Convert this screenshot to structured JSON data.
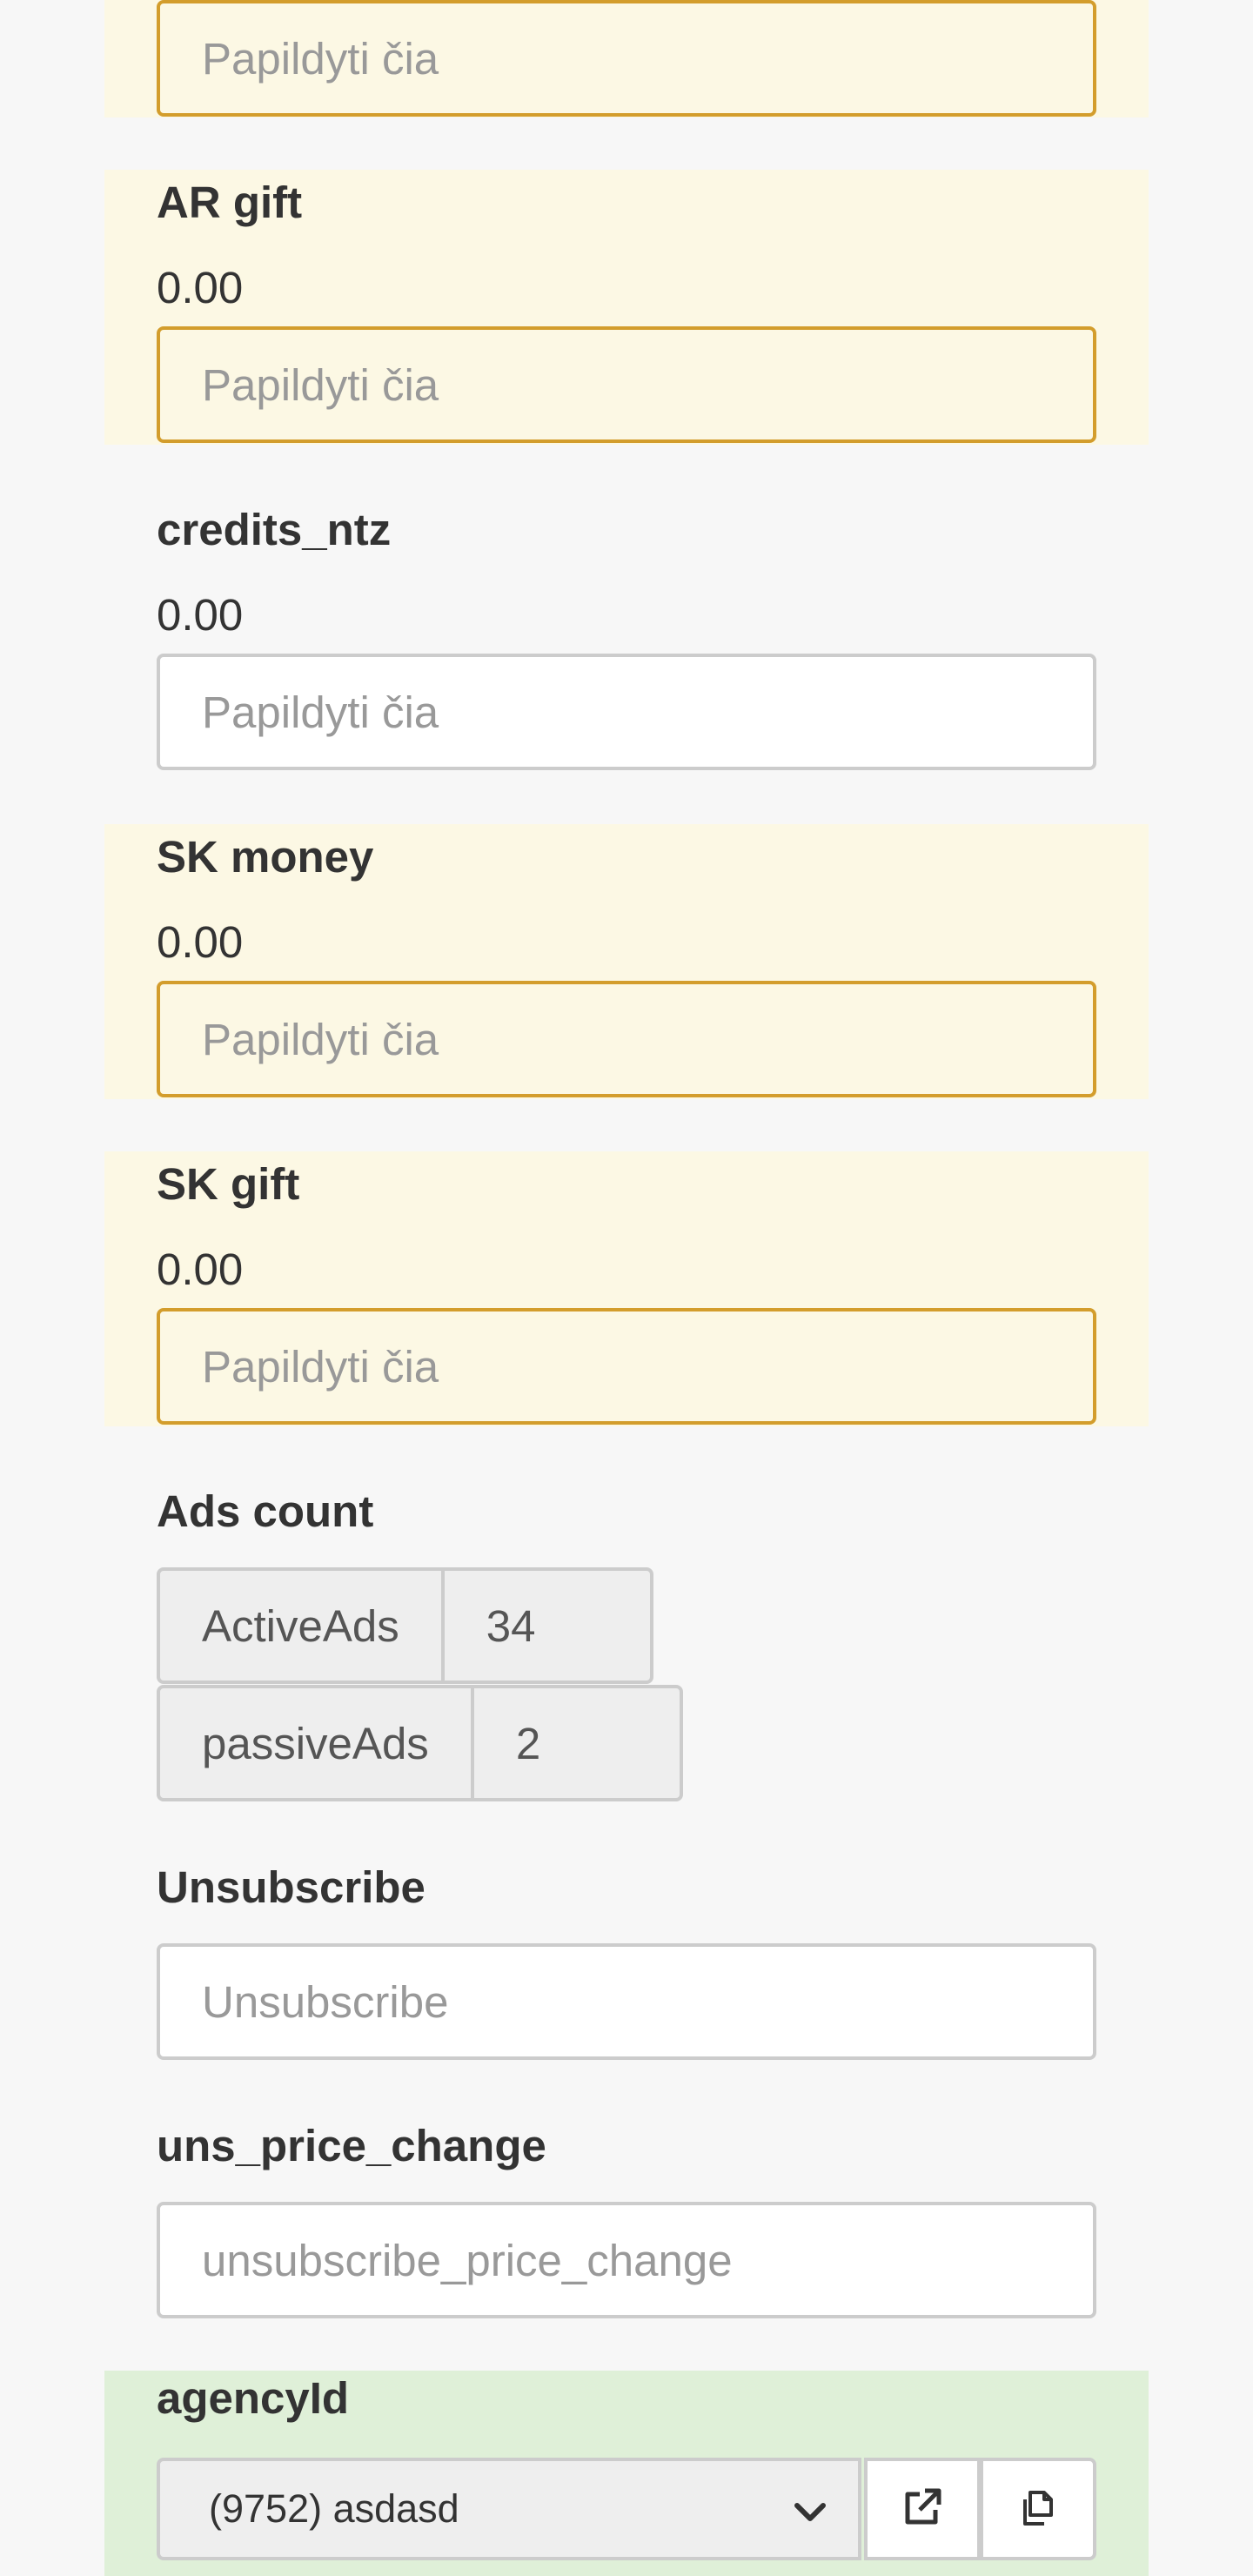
{
  "fields": {
    "top_input": {
      "placeholder": "Papildyti čia"
    },
    "ar_gift": {
      "label": "AR gift",
      "value": "0.00",
      "placeholder": "Papildyti čia"
    },
    "credits_ntz": {
      "label": "credits_ntz",
      "value": "0.00",
      "placeholder": "Papildyti čia"
    },
    "sk_money": {
      "label": "SK money",
      "value": "0.00",
      "placeholder": "Papildyti čia"
    },
    "sk_gift": {
      "label": "SK gift",
      "value": "0.00",
      "placeholder": "Papildyti čia"
    }
  },
  "ads_count": {
    "label": "Ads count",
    "active": {
      "addon": "ActiveAds",
      "value": "34"
    },
    "passive": {
      "addon": "passiveAds",
      "value": "2"
    }
  },
  "unsubscribe": {
    "label": "Unsubscribe",
    "placeholder": "Unsubscribe"
  },
  "uns_price_change": {
    "label": "uns_price_change",
    "placeholder": "unsubscribe_price_change"
  },
  "agency": {
    "label": "agencyId",
    "selected": "(9752) asdasd",
    "open_icon": "external-link-icon",
    "copy_icon": "copy-icon"
  },
  "colors": {
    "warning_bg": "#fcf8e4",
    "warning_border": "#d39d2c",
    "success_bg": "#dff0d8",
    "page_bg": "#f7f7f7"
  }
}
